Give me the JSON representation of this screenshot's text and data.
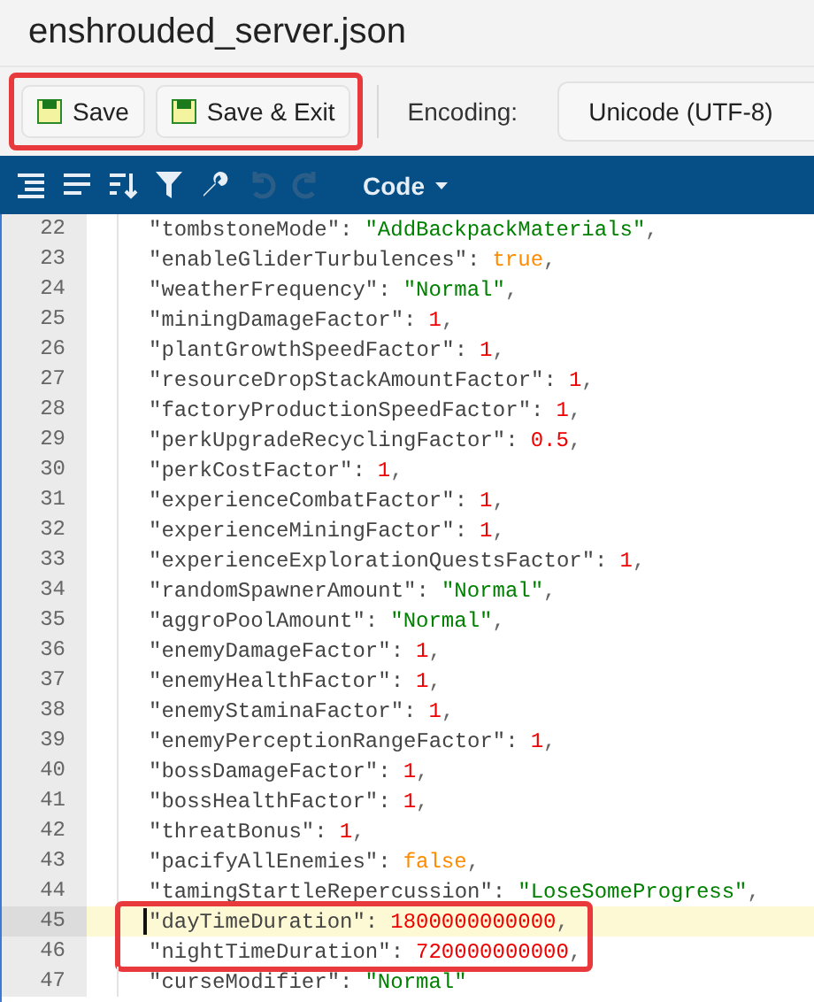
{
  "window": {
    "title": "enshrouded_server.json"
  },
  "toolbar": {
    "framed": true,
    "buttons": [
      {
        "label": "Save"
      },
      {
        "label": "Save & Exit"
      }
    ],
    "encoding": {
      "label": "Encoding:",
      "value": "Unicode (UTF-8)"
    }
  },
  "editor_toolbar": {
    "tools": [
      {
        "kind": "format",
        "disabled": false
      },
      {
        "kind": "compact",
        "disabled": false
      },
      {
        "kind": "sort",
        "disabled": false
      },
      {
        "kind": "filter",
        "disabled": false
      },
      {
        "kind": "repair",
        "disabled": false
      },
      {
        "kind": "undo",
        "disabled": true
      },
      {
        "kind": "redo",
        "disabled": true
      }
    ],
    "mode": "Code"
  },
  "lines": [
    {
      "number": "22",
      "key": "\"tombstoneMode\":",
      "value": "\"AddBackpackMaterials\"",
      "kind": "string",
      "trail": ",",
      "current": false,
      "framed": false
    },
    {
      "number": "23",
      "key": "\"enableGliderTurbulences\":",
      "value": "true",
      "kind": "boolean",
      "trail": ",",
      "current": false,
      "framed": false
    },
    {
      "number": "24",
      "key": "\"weatherFrequency\":",
      "value": "\"Normal\"",
      "kind": "string",
      "trail": ",",
      "current": false,
      "framed": false
    },
    {
      "number": "25",
      "key": "\"miningDamageFactor\":",
      "value": "1",
      "kind": "number",
      "trail": ",",
      "current": false,
      "framed": false
    },
    {
      "number": "26",
      "key": "\"plantGrowthSpeedFactor\":",
      "value": "1",
      "kind": "number",
      "trail": ",",
      "current": false,
      "framed": false
    },
    {
      "number": "27",
      "key": "\"resourceDropStackAmountFactor\":",
      "value": "1",
      "kind": "number",
      "trail": ",",
      "current": false,
      "framed": false
    },
    {
      "number": "28",
      "key": "\"factoryProductionSpeedFactor\":",
      "value": "1",
      "kind": "number",
      "trail": ",",
      "current": false,
      "framed": false
    },
    {
      "number": "29",
      "key": "\"perkUpgradeRecyclingFactor\":",
      "value": "0.5",
      "kind": "number",
      "trail": ",",
      "current": false,
      "framed": false
    },
    {
      "number": "30",
      "key": "\"perkCostFactor\":",
      "value": "1",
      "kind": "number",
      "trail": ",",
      "current": false,
      "framed": false
    },
    {
      "number": "31",
      "key": "\"experienceCombatFactor\":",
      "value": "1",
      "kind": "number",
      "trail": ",",
      "current": false,
      "framed": false
    },
    {
      "number": "32",
      "key": "\"experienceMiningFactor\":",
      "value": "1",
      "kind": "number",
      "trail": ",",
      "current": false,
      "framed": false
    },
    {
      "number": "33",
      "key": "\"experienceExplorationQuestsFactor\":",
      "value": "1",
      "kind": "number",
      "trail": ",",
      "current": false,
      "framed": false
    },
    {
      "number": "34",
      "key": "\"randomSpawnerAmount\":",
      "value": "\"Normal\"",
      "kind": "string",
      "trail": ",",
      "current": false,
      "framed": false
    },
    {
      "number": "35",
      "key": "\"aggroPoolAmount\":",
      "value": "\"Normal\"",
      "kind": "string",
      "trail": ",",
      "current": false,
      "framed": false
    },
    {
      "number": "36",
      "key": "\"enemyDamageFactor\":",
      "value": "1",
      "kind": "number",
      "trail": ",",
      "current": false,
      "framed": false
    },
    {
      "number": "37",
      "key": "\"enemyHealthFactor\":",
      "value": "1",
      "kind": "number",
      "trail": ",",
      "current": false,
      "framed": false
    },
    {
      "number": "38",
      "key": "\"enemyStaminaFactor\":",
      "value": "1",
      "kind": "number",
      "trail": ",",
      "current": false,
      "framed": false
    },
    {
      "number": "39",
      "key": "\"enemyPerceptionRangeFactor\":",
      "value": "1",
      "kind": "number",
      "trail": ",",
      "current": false,
      "framed": false
    },
    {
      "number": "40",
      "key": "\"bossDamageFactor\":",
      "value": "1",
      "kind": "number",
      "trail": ",",
      "current": false,
      "framed": false
    },
    {
      "number": "41",
      "key": "\"bossHealthFactor\":",
      "value": "1",
      "kind": "number",
      "trail": ",",
      "current": false,
      "framed": false
    },
    {
      "number": "42",
      "key": "\"threatBonus\":",
      "value": "1",
      "kind": "number",
      "trail": ",",
      "current": false,
      "framed": false
    },
    {
      "number": "43",
      "key": "\"pacifyAllEnemies\":",
      "value": "false",
      "kind": "boolean",
      "trail": ",",
      "current": false,
      "framed": false
    },
    {
      "number": "44",
      "key": "\"tamingStartleRepercussion\":",
      "value": "\"LoseSomeProgress\"",
      "kind": "string",
      "trail": ",",
      "current": false,
      "framed": false
    },
    {
      "number": "45",
      "key": "\"dayTimeDuration\":",
      "value": "1800000000000",
      "kind": "number",
      "trail": ",",
      "current": true,
      "framed": true
    },
    {
      "number": "46",
      "key": "\"nightTimeDuration\":",
      "value": "720000000000",
      "kind": "number",
      "trail": ",",
      "current": false,
      "framed": true
    },
    {
      "number": "47",
      "key": "\"curseModifier\":",
      "value": "\"Normal\"",
      "kind": "string",
      "current": false,
      "framed": false
    }
  ]
}
